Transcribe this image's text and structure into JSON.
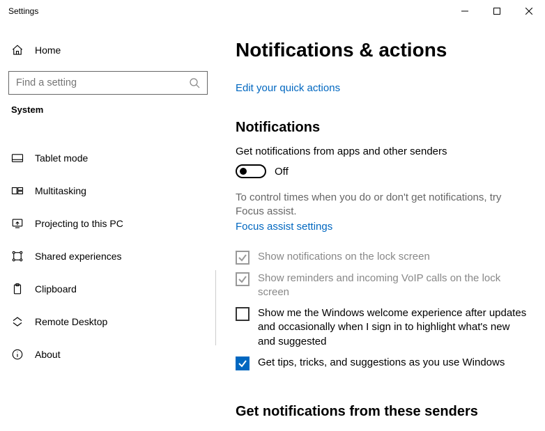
{
  "window": {
    "title": "Settings"
  },
  "sidebar": {
    "home": "Home",
    "search_placeholder": "Find a setting",
    "category": "System",
    "items": [
      {
        "label": "Tablet mode"
      },
      {
        "label": "Multitasking"
      },
      {
        "label": "Projecting to this PC"
      },
      {
        "label": "Shared experiences"
      },
      {
        "label": "Clipboard"
      },
      {
        "label": "Remote Desktop"
      },
      {
        "label": "About"
      }
    ]
  },
  "content": {
    "heading": "Notifications & actions",
    "edit_quick_actions": "Edit your quick actions",
    "notifications_heading": "Notifications",
    "get_notifications_label": "Get notifications from apps and other senders",
    "toggle_state": "Off",
    "help_text": "To control times when you do or don't get notifications, try Focus assist.",
    "focus_assist_link": "Focus assist settings",
    "checkboxes": [
      {
        "label": "Show notifications on the lock screen"
      },
      {
        "label": "Show reminders and incoming VoIP calls on the lock screen"
      },
      {
        "label": "Show me the Windows welcome experience after updates and occasionally when I sign in to highlight what's new and suggested"
      },
      {
        "label": "Get tips, tricks, and suggestions as you use Windows"
      }
    ],
    "senders_heading": "Get notifications from these senders"
  }
}
